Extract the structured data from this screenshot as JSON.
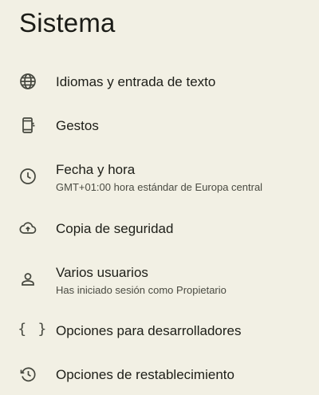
{
  "header": {
    "title": "Sistema"
  },
  "items": [
    {
      "id": "languages",
      "icon": "globe-icon",
      "title": "Idiomas y entrada de texto",
      "subtitle": ""
    },
    {
      "id": "gestures",
      "icon": "gestures-phone-icon",
      "title": "Gestos",
      "subtitle": ""
    },
    {
      "id": "datetime",
      "icon": "clock-icon",
      "title": "Fecha y hora",
      "subtitle": "GMT+01:00 hora estándar de Europa central"
    },
    {
      "id": "backup",
      "icon": "cloud-upload-icon",
      "title": "Copia de seguridad",
      "subtitle": ""
    },
    {
      "id": "users",
      "icon": "person-icon",
      "title": "Varios usuarios",
      "subtitle": "Has iniciado sesión como Propietario"
    },
    {
      "id": "developer",
      "icon": "code-braces-icon",
      "title": "Opciones para desarrolladores",
      "subtitle": ""
    },
    {
      "id": "reset",
      "icon": "history-icon",
      "title": "Opciones de restablecimiento",
      "subtitle": ""
    }
  ],
  "colors": {
    "background": "#f2f0e4",
    "text": "#1d1e18",
    "secondary_text": "#4a4b42",
    "icon": "#45473e"
  }
}
